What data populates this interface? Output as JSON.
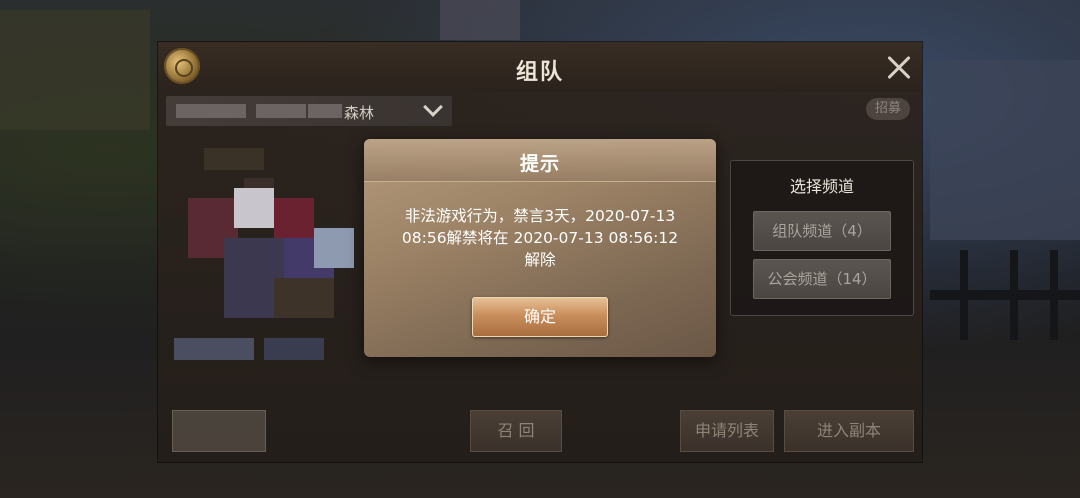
{
  "team_panel": {
    "title": "组队",
    "dungeon_name": "森林",
    "recruit_label": "招募"
  },
  "channel_panel": {
    "title": "选择频道",
    "team_channel": "组队频道（4）",
    "guild_channel": "公会频道（14）"
  },
  "bottom_bar": {
    "recall_label": "召 回",
    "apply_list_label": "申请列表",
    "enter_dungeon_label": "进入副本"
  },
  "alert": {
    "title": "提示",
    "message_line1": "非法游戏行为，禁言3天，2020-07-13",
    "message_line2": "08:56解禁将在 2020-07-13 08:56:12",
    "message_line3": "解除",
    "confirm_label": "确定"
  },
  "colors": {
    "dialog_bg": "#9e8467",
    "confirm_button": "#c98f5d",
    "panel_bg": "#2c241e"
  }
}
